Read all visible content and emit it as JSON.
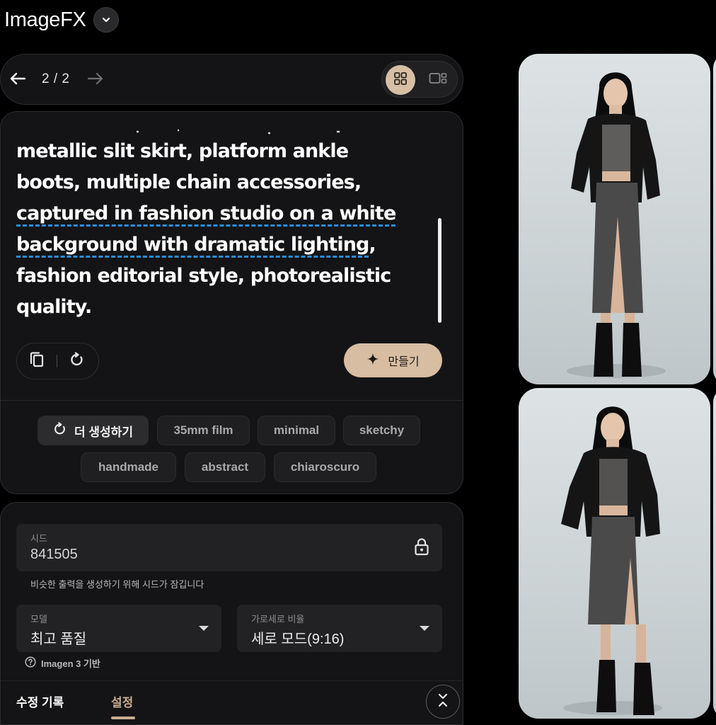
{
  "app": {
    "title": "ImageFX"
  },
  "nav": {
    "counter": "2 / 2"
  },
  "prompt": {
    "lines": [
      "metallic slit skirt, platform ankle",
      "boots, multiple chain accessories,",
      "captured in fashion studio on a white",
      "background with dramatic lighting",
      ",",
      "fashion editorial style, photorealistic",
      "quality."
    ],
    "create_label": "만들기"
  },
  "chips": {
    "more_label": "더 생성하기",
    "items": [
      "35mm film",
      "minimal",
      "sketchy",
      "handmade",
      "abstract",
      "chiaroscuro"
    ]
  },
  "settings": {
    "seed": {
      "label": "시드",
      "value": "841505",
      "hint": "비슷한 출력을 생성하기 위해 시드가 잠깁니다"
    },
    "model": {
      "label": "모델",
      "value": "최고 품질",
      "note": "Imagen 3 기반"
    },
    "ratio": {
      "label": "가로세로 비율",
      "value": "세로 모드(9:16)"
    },
    "tabs": {
      "history": "수정 기록",
      "settings": "설정"
    }
  },
  "colors": {
    "accent": "#d7bda1",
    "tab_active": "#c8ad8f",
    "underline_dash": "#2a8ee0",
    "panel_bg": "#141416",
    "page_bg": "#000000"
  },
  "icons": {
    "app_menu": "chevron-down-icon",
    "prev": "arrow-left-icon",
    "next": "arrow-right-icon",
    "grid_view": "grid-view-icon",
    "single_view": "single-view-icon",
    "copy": "copy-icon",
    "reset": "refresh-icon",
    "create": "sparkle-icon",
    "more": "refresh-icon",
    "lock": "lock-icon",
    "help": "help-circle-icon",
    "collapse": "collapse-icon"
  }
}
